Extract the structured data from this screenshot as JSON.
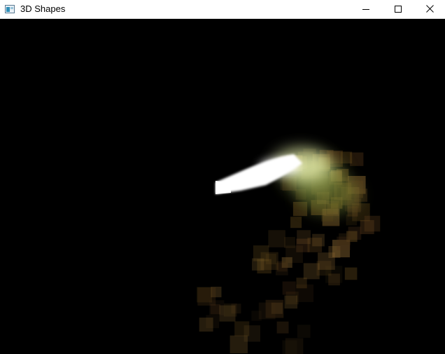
{
  "window": {
    "title": "3D Shapes",
    "app_icon": "window-app-icon",
    "controls": [
      "minimize-icon",
      "maximize-icon",
      "close-icon"
    ]
  },
  "scene": {
    "background": "#000000",
    "stream_color": "#ffffff",
    "glow_color": "#dfe89a",
    "particle_colors": [
      "#7a5a22",
      "#5c3f1b",
      "#4a3016",
      "#8f6b33",
      "#3a2a12"
    ]
  }
}
